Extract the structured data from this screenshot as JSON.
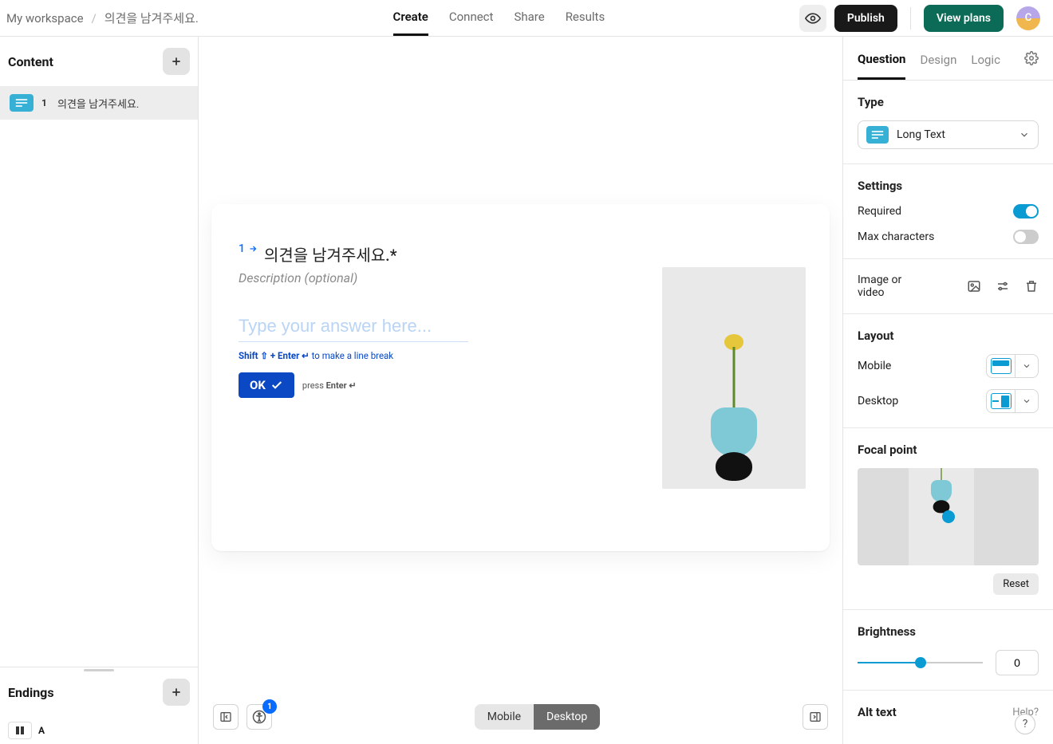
{
  "breadcrumb": {
    "workspace": "My workspace",
    "sep": "/",
    "title": "의견을 남겨주세요."
  },
  "topnav": {
    "create": "Create",
    "connect": "Connect",
    "share": "Share",
    "results": "Results"
  },
  "actions": {
    "publish": "Publish",
    "plans": "View plans",
    "avatar_letter": "C"
  },
  "left": {
    "content_header": "Content",
    "endings_header": "Endings",
    "items": [
      {
        "index": "1",
        "label": "의견을 남겨주세요."
      }
    ],
    "ending_letter": "A"
  },
  "canvas": {
    "q_index": "1",
    "title": "의견을 남겨주세요.*",
    "description_placeholder": "Description (optional)",
    "answer_placeholder": "Type your answer here...",
    "hint_pre": "Shift ⇧ + Enter ↵",
    "hint_post": " to make a line break",
    "ok": "OK",
    "press": "press ",
    "enter": "Enter ↵"
  },
  "bottom": {
    "a11y_badge": "1",
    "mobile": "Mobile",
    "desktop": "Desktop"
  },
  "right": {
    "tabs": {
      "question": "Question",
      "design": "Design",
      "logic": "Logic"
    },
    "type_header": "Type",
    "type_value": "Long Text",
    "settings_header": "Settings",
    "required_label": "Required",
    "maxchars_label": "Max characters",
    "media_header": "Image or video",
    "layout_header": "Layout",
    "layout_mobile": "Mobile",
    "layout_desktop": "Desktop",
    "focal_header": "Focal point",
    "reset": "Reset",
    "brightness_header": "Brightness",
    "brightness_value": "0",
    "alt_header": "Alt text",
    "help": "Help?"
  }
}
